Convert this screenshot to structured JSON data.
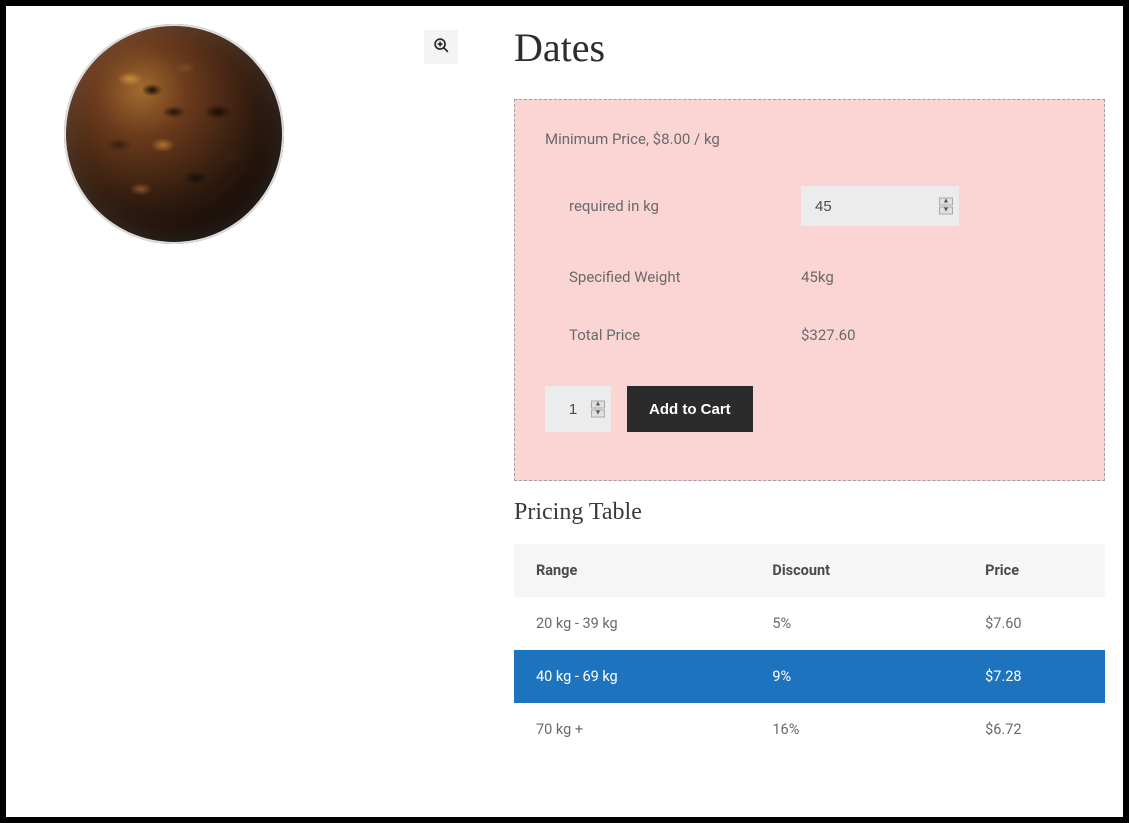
{
  "product": {
    "title": "Dates",
    "min_price_text": "Minimum Price, $8.00 / kg",
    "labels": {
      "required": "required in kg",
      "specified_weight": "Specified Weight",
      "total_price": "Total Price"
    },
    "values": {
      "kg_input": "45",
      "specified_weight": "45kg",
      "total_price": "$327.60",
      "qty": "1"
    },
    "add_to_cart_label": "Add to Cart"
  },
  "pricing_table": {
    "title": "Pricing Table",
    "headers": {
      "range": "Range",
      "discount": "Discount",
      "price": "Price"
    },
    "rows": [
      {
        "range": "20 kg - 39 kg",
        "discount": "5%",
        "price": "$7.60",
        "active": false
      },
      {
        "range": "40 kg - 69 kg",
        "discount": "9%",
        "price": "$7.28",
        "active": true
      },
      {
        "range": "70 kg +",
        "discount": "16%",
        "price": "$6.72",
        "active": false
      }
    ]
  },
  "chart_data": {
    "type": "table",
    "title": "Pricing Table",
    "columns": [
      "Range",
      "Discount",
      "Price"
    ],
    "rows": [
      [
        "20 kg - 39 kg",
        "5%",
        "$7.60"
      ],
      [
        "40 kg - 69 kg",
        "9%",
        "$7.28"
      ],
      [
        "70 kg +",
        "16%",
        "$6.72"
      ]
    ],
    "highlighted_row_index": 1
  }
}
